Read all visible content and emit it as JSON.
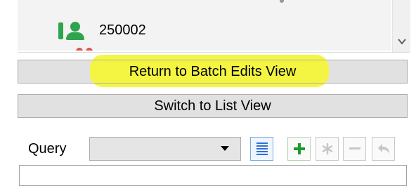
{
  "list": {
    "item_label": "250002"
  },
  "buttons": {
    "return_label": "Return to Batch Edits View",
    "switch_label": "Switch to List View"
  },
  "query": {
    "label": "Query",
    "selected_value": ""
  },
  "toolbar": {
    "icons": [
      "list-view-icon",
      "add-icon",
      "asterisk-icon",
      "minus-icon",
      "undo-icon"
    ]
  },
  "colors": {
    "highlight": "#f4f53a",
    "user_icon": "#2ea44f",
    "list_icon": "#2f6fd6"
  }
}
